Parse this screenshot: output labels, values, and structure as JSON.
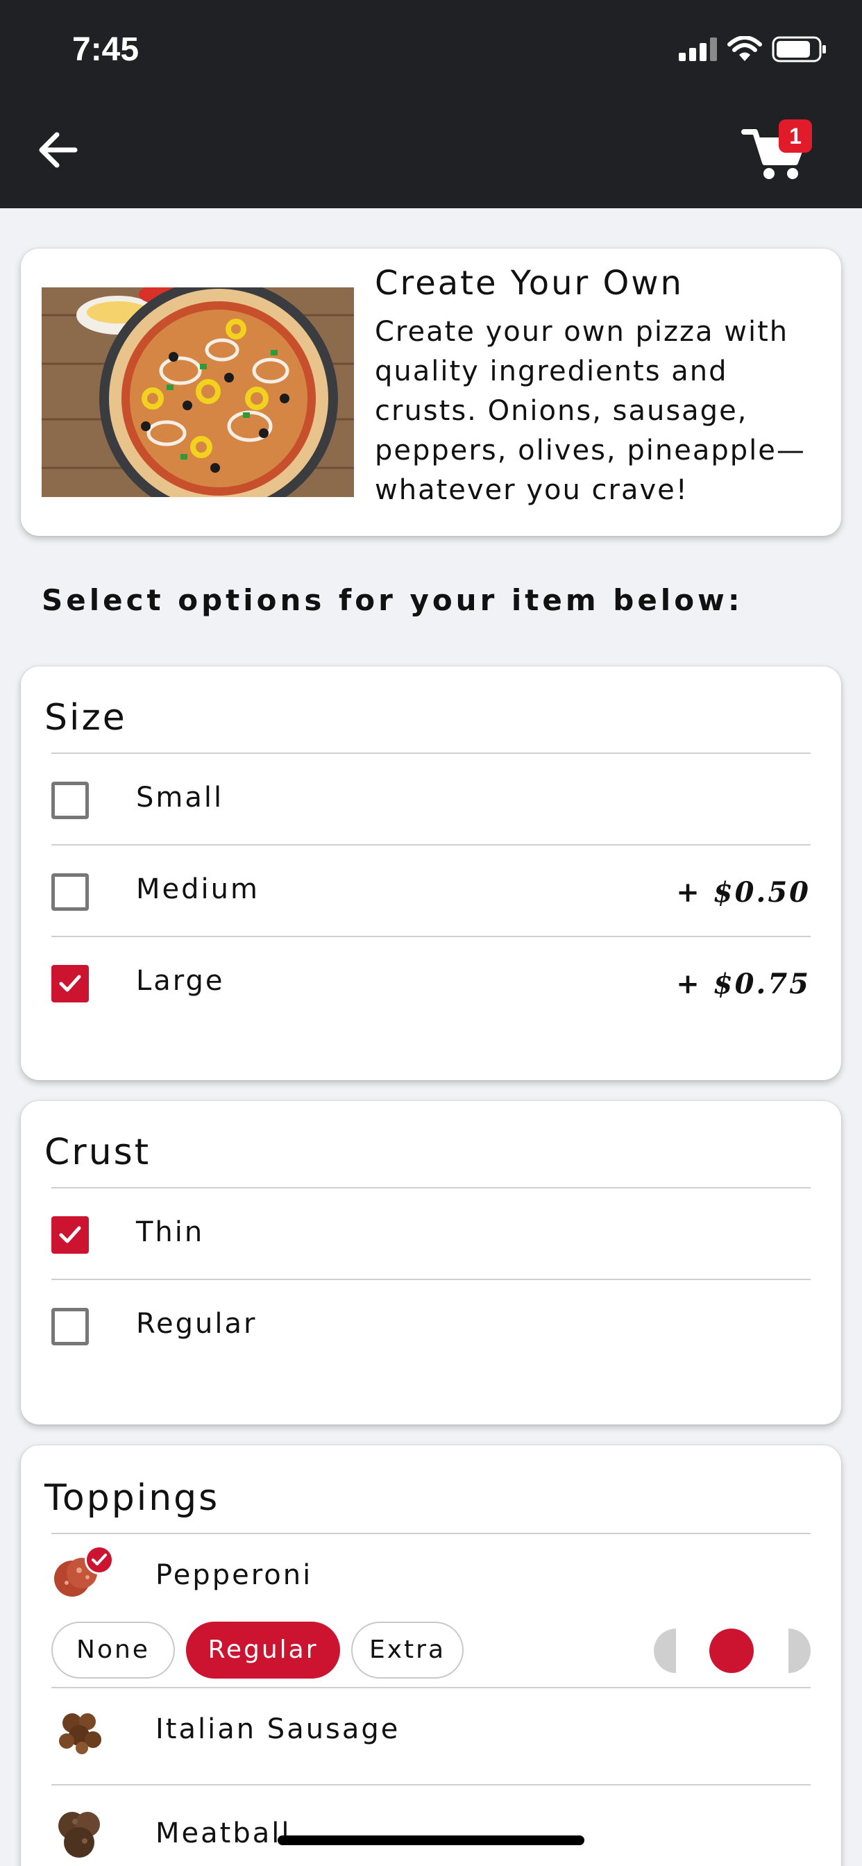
{
  "status_bar": {
    "time": "7:45"
  },
  "header": {
    "cart_count": "1",
    "accent": "#e21b2b"
  },
  "item": {
    "title": "Create Your Own",
    "description": "Create your own pizza with quality ingredients and crusts. Onions, sausage, peppers, olives, pineapple—whatever you crave!"
  },
  "select_heading": "Select options for your item below:",
  "size": {
    "title": "Size",
    "options": [
      {
        "label": "Small",
        "price": "",
        "checked": false
      },
      {
        "label": "Medium",
        "price": "+ $0.50",
        "checked": false
      },
      {
        "label": "Large",
        "price": "+ $0.75",
        "checked": true
      }
    ]
  },
  "crust": {
    "title": "Crust",
    "options": [
      {
        "label": "Thin",
        "checked": true
      },
      {
        "label": "Regular",
        "checked": false
      }
    ]
  },
  "toppings": {
    "title": "Toppings",
    "items": [
      {
        "label": "Pepperoni",
        "selected": true,
        "icon": "pepperoni-icon"
      },
      {
        "label": "Italian Sausage",
        "selected": false,
        "icon": "sausage-icon"
      },
      {
        "label": "Meatball",
        "selected": false,
        "icon": "meatball-icon"
      }
    ],
    "amount_options": [
      "None",
      "Regular",
      "Extra"
    ],
    "amount_selected": "Regular"
  },
  "colors": {
    "brand_red": "#cc1330",
    "header_bg": "#202125",
    "page_bg": "#f1f2f6"
  }
}
